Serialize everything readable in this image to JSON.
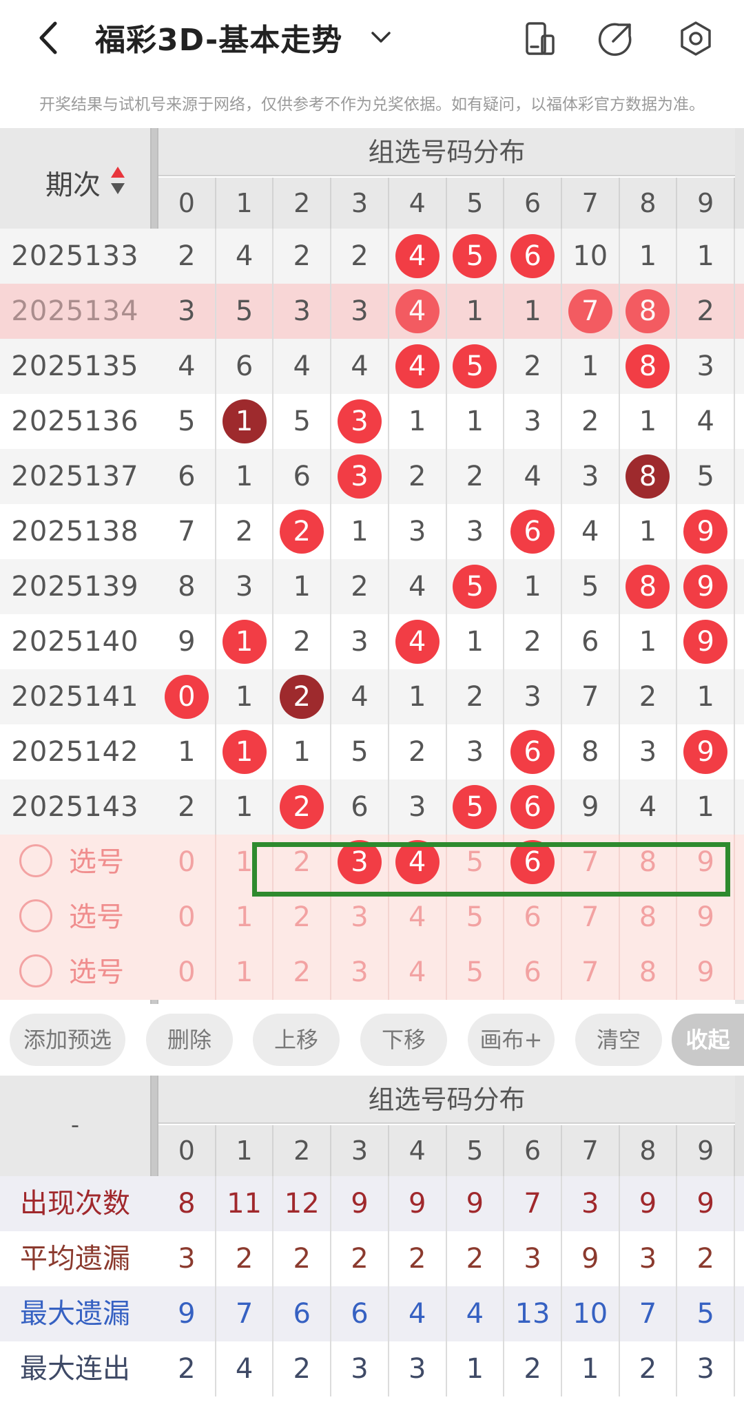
{
  "header": {
    "title": "福彩3D-基本走势",
    "notice": "开奖结果与试机号来源于网络，仅供参考不作为兑奖依据。如有疑问，以福体彩官方数据为准。"
  },
  "table": {
    "section_title": "组选号码分布",
    "period_label": "期次",
    "digits": [
      "0",
      "1",
      "2",
      "3",
      "4",
      "5",
      "6",
      "7",
      "8",
      "9"
    ],
    "rows": [
      {
        "period": "2025133",
        "cells": [
          {
            "v": "2"
          },
          {
            "v": "4"
          },
          {
            "v": "2"
          },
          {
            "v": "2"
          },
          {
            "v": "4",
            "ball": "red"
          },
          {
            "v": "5",
            "ball": "red"
          },
          {
            "v": "6",
            "ball": "red"
          },
          {
            "v": "10"
          },
          {
            "v": "1"
          },
          {
            "v": "1"
          }
        ]
      },
      {
        "period": "2025134",
        "cells": [
          {
            "v": "3"
          },
          {
            "v": "5"
          },
          {
            "v": "3"
          },
          {
            "v": "3"
          },
          {
            "v": "4",
            "ball": "red"
          },
          {
            "v": "1"
          },
          {
            "v": "1"
          },
          {
            "v": "7",
            "ball": "red"
          },
          {
            "v": "8",
            "ball": "red"
          },
          {
            "v": "2"
          }
        ]
      },
      {
        "period": "2025135",
        "cells": [
          {
            "v": "4"
          },
          {
            "v": "6"
          },
          {
            "v": "4"
          },
          {
            "v": "4"
          },
          {
            "v": "4",
            "ball": "red"
          },
          {
            "v": "5",
            "ball": "red"
          },
          {
            "v": "2"
          },
          {
            "v": "1"
          },
          {
            "v": "8",
            "ball": "red"
          },
          {
            "v": "3"
          }
        ]
      },
      {
        "period": "2025136",
        "cells": [
          {
            "v": "5"
          },
          {
            "v": "1",
            "ball": "dark"
          },
          {
            "v": "5"
          },
          {
            "v": "3",
            "ball": "red"
          },
          {
            "v": "1"
          },
          {
            "v": "1"
          },
          {
            "v": "3"
          },
          {
            "v": "2"
          },
          {
            "v": "1"
          },
          {
            "v": "4"
          }
        ]
      },
      {
        "period": "2025137",
        "cells": [
          {
            "v": "6"
          },
          {
            "v": "1"
          },
          {
            "v": "6"
          },
          {
            "v": "3",
            "ball": "red"
          },
          {
            "v": "2"
          },
          {
            "v": "2"
          },
          {
            "v": "4"
          },
          {
            "v": "3"
          },
          {
            "v": "8",
            "ball": "dark"
          },
          {
            "v": "5"
          }
        ]
      },
      {
        "period": "2025138",
        "cells": [
          {
            "v": "7"
          },
          {
            "v": "2"
          },
          {
            "v": "2",
            "ball": "red"
          },
          {
            "v": "1"
          },
          {
            "v": "3"
          },
          {
            "v": "3"
          },
          {
            "v": "6",
            "ball": "red"
          },
          {
            "v": "4"
          },
          {
            "v": "1"
          },
          {
            "v": "9",
            "ball": "red"
          }
        ]
      },
      {
        "period": "2025139",
        "cells": [
          {
            "v": "8"
          },
          {
            "v": "3"
          },
          {
            "v": "1"
          },
          {
            "v": "2"
          },
          {
            "v": "4"
          },
          {
            "v": "5",
            "ball": "red"
          },
          {
            "v": "1"
          },
          {
            "v": "5"
          },
          {
            "v": "8",
            "ball": "red"
          },
          {
            "v": "9",
            "ball": "red"
          }
        ]
      },
      {
        "period": "2025140",
        "cells": [
          {
            "v": "9"
          },
          {
            "v": "1",
            "ball": "red"
          },
          {
            "v": "2"
          },
          {
            "v": "3"
          },
          {
            "v": "4",
            "ball": "red"
          },
          {
            "v": "1"
          },
          {
            "v": "2"
          },
          {
            "v": "6"
          },
          {
            "v": "1"
          },
          {
            "v": "9",
            "ball": "red"
          }
        ]
      },
      {
        "period": "2025141",
        "cells": [
          {
            "v": "0",
            "ball": "red"
          },
          {
            "v": "1"
          },
          {
            "v": "2",
            "ball": "dark"
          },
          {
            "v": "4"
          },
          {
            "v": "1"
          },
          {
            "v": "2"
          },
          {
            "v": "3"
          },
          {
            "v": "7"
          },
          {
            "v": "2"
          },
          {
            "v": "1"
          }
        ]
      },
      {
        "period": "2025142",
        "cells": [
          {
            "v": "1"
          },
          {
            "v": "1",
            "ball": "red"
          },
          {
            "v": "1"
          },
          {
            "v": "5"
          },
          {
            "v": "2"
          },
          {
            "v": "3"
          },
          {
            "v": "6",
            "ball": "red"
          },
          {
            "v": "8"
          },
          {
            "v": "3"
          },
          {
            "v": "9",
            "ball": "red"
          }
        ]
      },
      {
        "period": "2025143",
        "cells": [
          {
            "v": "2"
          },
          {
            "v": "1"
          },
          {
            "v": "2",
            "ball": "red"
          },
          {
            "v": "6"
          },
          {
            "v": "3"
          },
          {
            "v": "5",
            "ball": "red"
          },
          {
            "v": "6",
            "ball": "red"
          },
          {
            "v": "9"
          },
          {
            "v": "4"
          },
          {
            "v": "1"
          }
        ]
      }
    ],
    "highlighted_row": "2025134",
    "select_rows": [
      {
        "label": "选号",
        "selected": [
          "3",
          "4",
          "6"
        ]
      },
      {
        "label": "选号",
        "selected": []
      },
      {
        "label": "选号",
        "selected": []
      }
    ]
  },
  "buttons": {
    "add_preselect": "添加预选",
    "delete": "删除",
    "move_up": "上移",
    "move_down": "下移",
    "canvas_plus": "画布+",
    "clear": "清空",
    "collapse": "收起"
  },
  "stats": {
    "section_title": "组选号码分布",
    "corner_label": "-",
    "digits": [
      "0",
      "1",
      "2",
      "3",
      "4",
      "5",
      "6",
      "7",
      "8",
      "9"
    ],
    "rows": [
      {
        "label": "出现次数",
        "color": "#a0282c",
        "values": [
          "8",
          "11",
          "12",
          "9",
          "9",
          "9",
          "7",
          "3",
          "9",
          "9"
        ]
      },
      {
        "label": "平均遗漏",
        "color": "#8b3a2e",
        "values": [
          "3",
          "2",
          "2",
          "2",
          "2",
          "2",
          "3",
          "9",
          "3",
          "2"
        ]
      },
      {
        "label": "最大遗漏",
        "color": "#3661c2",
        "values": [
          "9",
          "7",
          "6",
          "6",
          "4",
          "4",
          "13",
          "10",
          "7",
          "5"
        ]
      },
      {
        "label": "最大连出",
        "color": "#3f4a66",
        "values": [
          "2",
          "4",
          "2",
          "3",
          "3",
          "1",
          "2",
          "1",
          "2",
          "3"
        ]
      }
    ]
  },
  "colors": {
    "accent_red": "#f23d45",
    "dark_red": "#9e2a2d",
    "highlight_row": "#f8d6d6",
    "select_bg": "#fde9e6",
    "green_frame": "#2e8a2e"
  }
}
